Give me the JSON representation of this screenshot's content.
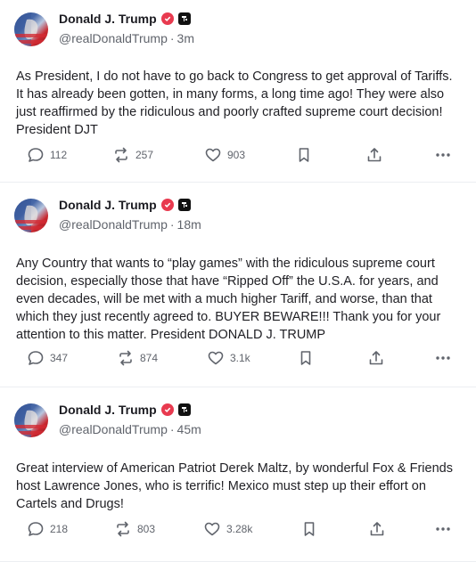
{
  "posts": [
    {
      "author_name": "Donald J. Trump",
      "handle": "@realDonaldTrump",
      "separator": "·",
      "time": "3m",
      "text": "As President, I do not have to go back to Congress to get approval of Tariffs. It has already been gotten, in many forms, a long time ago! They were also just reaffirmed by the ridiculous and poorly crafted supreme court decision! President DJT",
      "replies": "112",
      "reposts": "257",
      "likes": "903"
    },
    {
      "author_name": "Donald J. Trump",
      "handle": "@realDonaldTrump",
      "separator": "·",
      "time": "18m",
      "text": "Any Country that wants to “play games” with the ridiculous supreme court decision, especially those that have “Ripped Off” the U.S.A. for years, and even decades, will be met with a much higher Tariff, and worse, than that which they just recently agreed to. BUYER BEWARE!!! Thank you for your attention to this matter. President DONALD J. TRUMP",
      "replies": "347",
      "reposts": "874",
      "likes": "3.1k"
    },
    {
      "author_name": "Donald J. Trump",
      "handle": "@realDonaldTrump",
      "separator": "·",
      "time": "45m",
      "text": "Great interview of American Patriot Derek Maltz, by wonderful Fox & Friends host Lawrence Jones, who is terrific! Mexico must step up their effort on Cartels and Drugs!",
      "replies": "218",
      "reposts": "803",
      "likes": "3.28k"
    }
  ],
  "colors": {
    "verified": "#e83a4f",
    "muted": "#60646c",
    "text": "#1f1f24"
  },
  "icons": [
    "avatar",
    "verified-badge-icon",
    "platform-icon",
    "reply-icon",
    "repost-icon",
    "like-icon",
    "bookmark-icon",
    "share-icon",
    "more-icon"
  ]
}
